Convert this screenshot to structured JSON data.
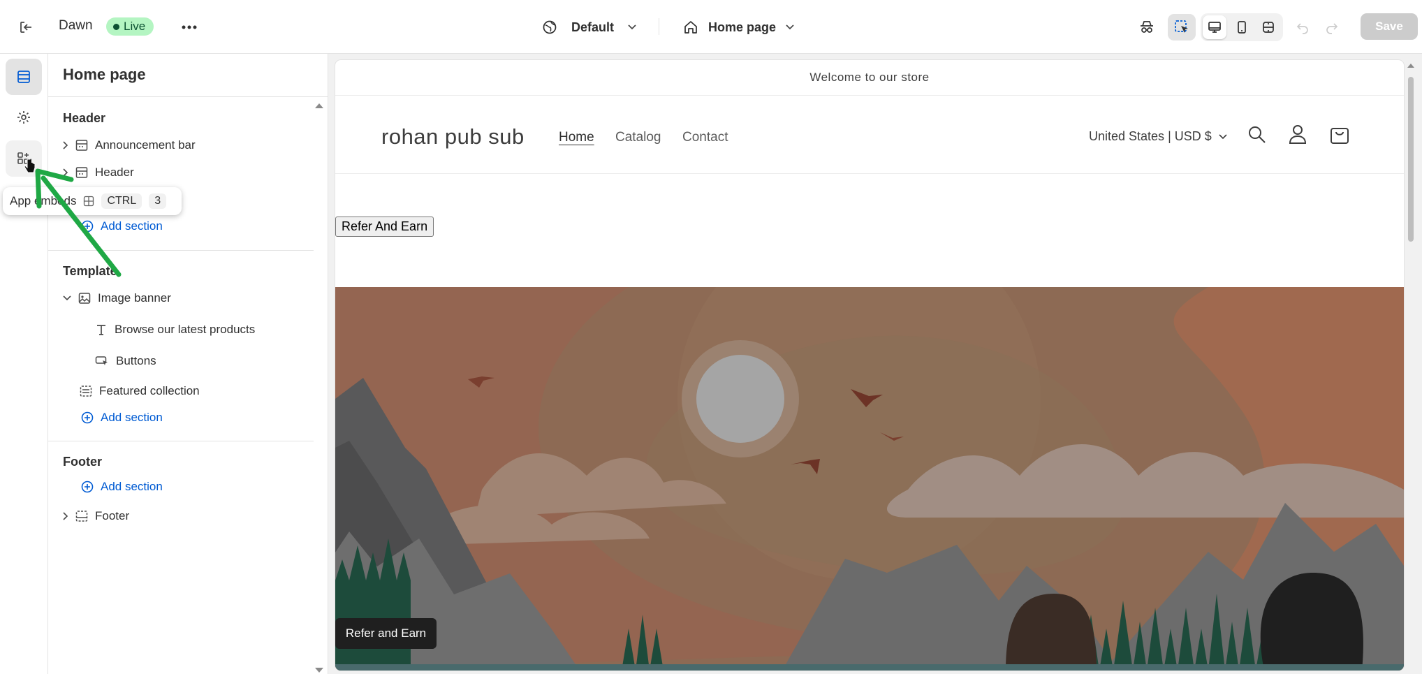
{
  "topbar": {
    "theme_name": "Dawn",
    "live_badge": "Live",
    "more_icon": "ellipsis-icon",
    "market_selector": "Default",
    "page_selector": "Home page",
    "save_label": "Save"
  },
  "rail": {
    "items": [
      {
        "icon": "sections-icon",
        "active": true
      },
      {
        "icon": "gear-icon",
        "active": false
      },
      {
        "icon": "apps-icon",
        "active": false
      }
    ],
    "tooltip": {
      "label": "App embeds",
      "kbd_ctrl": "CTRL",
      "kbd_key": "3"
    }
  },
  "panel": {
    "title": "Home page",
    "header_group": {
      "label": "Header",
      "items": [
        "Announcement bar",
        "Header"
      ],
      "add_label": "Add section"
    },
    "template_group": {
      "label": "Template",
      "image_banner": "Image banner",
      "banner_children": [
        "Browse our latest products",
        "Buttons"
      ],
      "featured": "Featured collection",
      "add_label": "Add section"
    },
    "footer_group": {
      "label": "Footer",
      "add_label": "Add section",
      "footer_item": "Footer"
    }
  },
  "preview": {
    "announcement": "Welcome to our store",
    "store_name": "rohan pub sub",
    "nav": [
      "Home",
      "Catalog",
      "Contact"
    ],
    "currency": "United States | USD $",
    "refer_button": "Refer And Earn",
    "refer_floating": "Refer and Earn"
  },
  "colors": {
    "live_bg": "#b4f5c2",
    "link_blue": "#005bd3",
    "arrow_green": "#1fa845"
  }
}
